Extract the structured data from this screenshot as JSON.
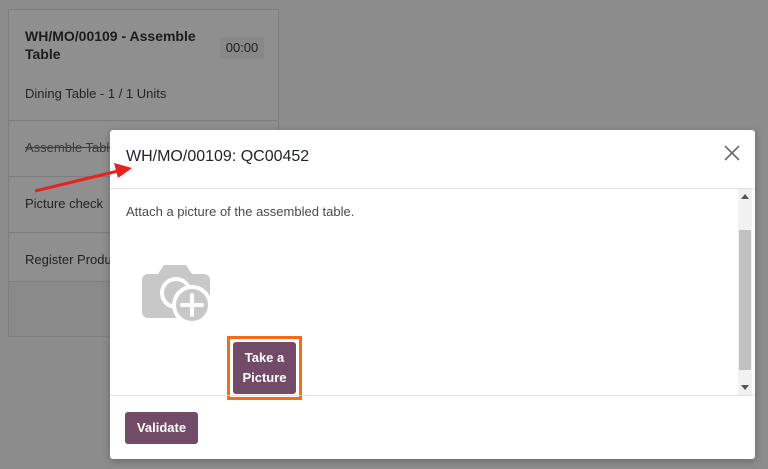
{
  "background": {
    "title": "WH/MO/00109 - Assemble Table",
    "timer": "00:00",
    "subtitle": "Dining Table - 1 / 1 Units",
    "steps": [
      {
        "label": "Assemble Table"
      },
      {
        "label": "Picture check"
      },
      {
        "label": "Register Production"
      }
    ]
  },
  "dialog": {
    "title": "WH/MO/00109: QC00452",
    "instruction": "Attach a picture of the assembled table.",
    "take_picture_line1": "Take a",
    "take_picture_line2": "Picture",
    "validate_label": "Validate"
  },
  "colors": {
    "primary": "#714b67",
    "highlight": "#f86a15",
    "annotation_arrow": "#e8221c"
  },
  "icons": {
    "close": "close-icon",
    "camera": "camera-add-icon"
  }
}
